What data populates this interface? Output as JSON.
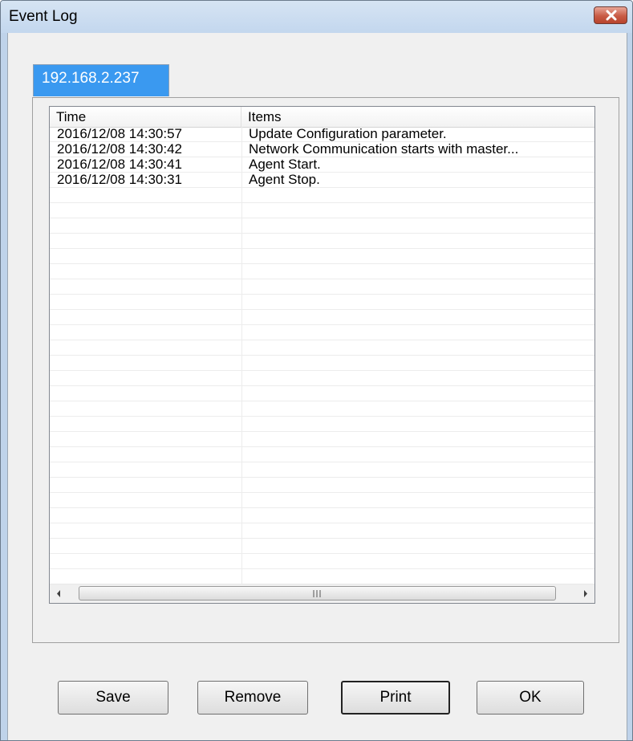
{
  "window": {
    "title": "Event Log"
  },
  "tabs": [
    {
      "label": "192.168.2.237"
    }
  ],
  "table": {
    "columns": [
      "Time",
      "Items"
    ],
    "rows": [
      [
        "2016/12/08 14:30:57",
        "Update Configuration parameter."
      ],
      [
        "2016/12/08 14:30:42",
        "Network Communication starts with master..."
      ],
      [
        "2016/12/08 14:30:41",
        "Agent Start."
      ],
      [
        "2016/12/08 14:30:31",
        "Agent Stop."
      ]
    ]
  },
  "buttons": {
    "save": "Save",
    "remove": "Remove",
    "print": "Print",
    "ok": "OK"
  },
  "colors": {
    "tab_active": "#3a99f0",
    "close_button": "#c85b45",
    "titlebar": "#c3d7ee"
  }
}
